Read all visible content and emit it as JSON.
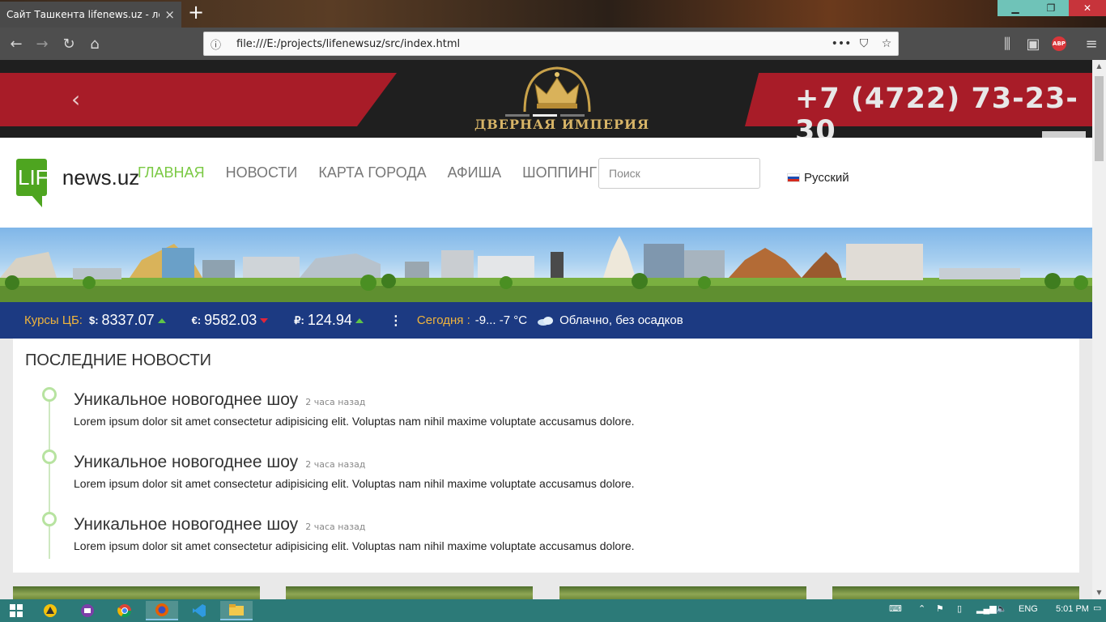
{
  "browser": {
    "tab_title": "Сайт Ташкента lifenews.uz - лента",
    "tab_close": "×",
    "new_tab": "+",
    "url": "file:///E:/projects/lifenewsuz/src/index.html",
    "page_actions": "•••"
  },
  "ad": {
    "prev_arrow": "‹",
    "phone": "+7 (4722) 73-23-30",
    "brand": "ДВЕРНАЯ ИМПЕРИЯ",
    "slides_total": 3,
    "active_slide": 2
  },
  "header": {
    "logo": {
      "part1": "LIFE",
      "part2": "news.uz"
    },
    "menu": [
      {
        "label": "ГЛАВНАЯ",
        "active": true
      },
      {
        "label": "НОВОСТИ",
        "active": false
      },
      {
        "label": "КАРТА ГОРОДА",
        "active": false
      },
      {
        "label": "АФИША",
        "active": false
      },
      {
        "label": "ШОППИНГ",
        "active": false
      }
    ],
    "search_placeholder": "Поиск",
    "language": "Русский"
  },
  "infobar": {
    "rates_label": "Курсы ЦБ:",
    "rates": [
      {
        "symbol": "$:",
        "value": "8337.07",
        "trend": "up"
      },
      {
        "symbol": "€:",
        "value": "9582.03",
        "trend": "down"
      },
      {
        "symbol": "₽:",
        "value": "124.94",
        "trend": "up"
      }
    ],
    "today_label": "Сегодня :",
    "temperature": "-9... -7 °C",
    "weather": "Облачно, без осадков"
  },
  "news": {
    "heading": "ПОСЛЕДНИЕ НОВОСТИ",
    "items": [
      {
        "title": "Уникальное новогоднее шоу",
        "time": "2 часа назад",
        "text": "Lorem ipsum dolor sit amet consectetur adipisicing elit. Voluptas nam nihil maxime voluptate accusamus dolore."
      },
      {
        "title": "Уникальное новогоднее шоу",
        "time": "2 часа назад",
        "text": "Lorem ipsum dolor sit amet consectetur adipisicing elit. Voluptas nam nihil maxime voluptate accusamus dolore."
      },
      {
        "title": "Уникальное новогоднее шоу",
        "time": "2 часа назад",
        "text": "Lorem ipsum dolor sit amet consectetur adipisicing elit. Voluptas nam nihil maxime voluptate accusamus dolore."
      }
    ]
  },
  "taskbar": {
    "language": "ENG",
    "clock": "5:01 PM"
  },
  "colors": {
    "accent_green": "#7ac943",
    "infobar_blue": "#1c3a82",
    "highlight_orange": "#f0b43c",
    "ad_red": "#a81c28"
  }
}
